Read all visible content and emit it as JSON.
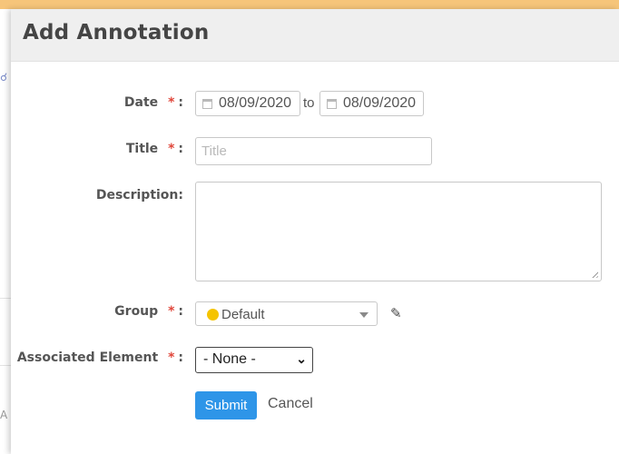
{
  "dialog": {
    "title": "Add Annotation"
  },
  "form": {
    "date": {
      "label": "Date",
      "required_mark": "*",
      "colon": ":",
      "start_value": "08/09/2020",
      "separator": "to",
      "end_value": "08/09/2020",
      "icon": "calendar-icon"
    },
    "title": {
      "label": "Title",
      "required_mark": "*",
      "colon": ":",
      "placeholder": "Title",
      "value": ""
    },
    "description": {
      "label": "Description:",
      "value": ""
    },
    "group": {
      "label": "Group",
      "required_mark": "*",
      "colon": ":",
      "selected": "Default",
      "dot_color": "#f5c400",
      "edit_icon": "pencil-icon"
    },
    "associated_element": {
      "label": "Associated Element",
      "required_mark": "*",
      "colon": ":",
      "selected": "- None -"
    }
  },
  "actions": {
    "submit_label": "Submit",
    "cancel_label": "Cancel"
  },
  "colors": {
    "accent": "#2e95e8",
    "required": "#e0463a",
    "top_strip": "#f6c57a"
  }
}
